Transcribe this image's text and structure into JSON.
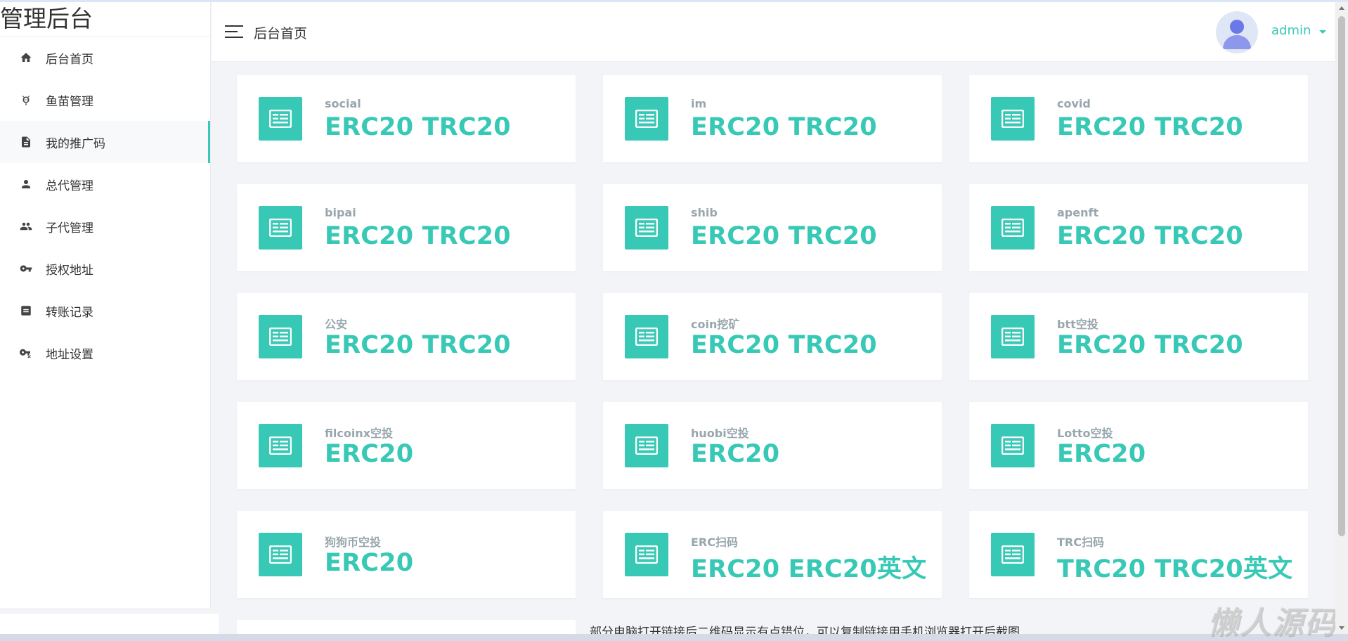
{
  "brand": {
    "title": "管理后台"
  },
  "sidebar": {
    "items": [
      {
        "label": "后台首页",
        "icon": "home-icon"
      },
      {
        "label": "鱼苗管理",
        "icon": "fish-icon"
      },
      {
        "label": "我的推广码",
        "icon": "document-icon",
        "active": true
      },
      {
        "label": "总代管理",
        "icon": "person-icon"
      },
      {
        "label": "子代管理",
        "icon": "people-icon"
      },
      {
        "label": "授权地址",
        "icon": "key-icon"
      },
      {
        "label": "转账记录",
        "icon": "record-icon"
      },
      {
        "label": "地址设置",
        "icon": "key-settings-icon"
      }
    ]
  },
  "header": {
    "page_title": "后台首页",
    "user": "admin"
  },
  "cards": [
    {
      "label": "social",
      "value": "ERC20 TRC20"
    },
    {
      "label": "im",
      "value": "ERC20 TRC20"
    },
    {
      "label": "covid",
      "value": "ERC20 TRC20"
    },
    {
      "label": "bipai",
      "value": "ERC20 TRC20"
    },
    {
      "label": "shib",
      "value": "ERC20 TRC20"
    },
    {
      "label": "apenft",
      "value": "ERC20 TRC20"
    },
    {
      "label": "公安",
      "value": "ERC20 TRC20"
    },
    {
      "label": "coin挖矿",
      "value": "ERC20 TRC20"
    },
    {
      "label": "btt空投",
      "value": "ERC20 TRC20"
    },
    {
      "label": "filcoinx空投",
      "value": "ERC20"
    },
    {
      "label": "huobi空投",
      "value": "ERC20"
    },
    {
      "label": "Lotto空投",
      "value": "ERC20"
    },
    {
      "label": "狗狗币空投",
      "value": "ERC20"
    },
    {
      "label": "ERC扫码",
      "value": "ERC20 ERC20英文"
    },
    {
      "label": "TRC扫码",
      "value": "TRC20 TRC20英文"
    }
  ],
  "notice": "部分电脑打开链接后二维码显示有点错位，可以复制链接用手机浏览器打开后截图",
  "watermark": "懒人源码",
  "colors": {
    "accent": "#38c9b6",
    "label": "#98a6ad",
    "background": "#f3f4f7"
  }
}
